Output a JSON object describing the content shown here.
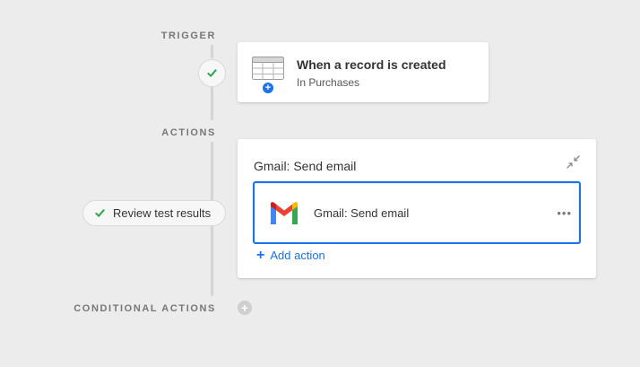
{
  "sections": {
    "trigger_label": "TRIGGER",
    "actions_label": "ACTIONS",
    "conditional_label": "CONDITIONAL ACTIONS"
  },
  "trigger": {
    "title": "When a record is created",
    "subtitle": "In Purchases",
    "icon": "table-icon",
    "status_icon": "check-icon"
  },
  "actions": {
    "header": "Gmail: Send email",
    "items": [
      {
        "label": "Gmail: Send email",
        "icon": "gmail-icon",
        "more": "•••"
      }
    ],
    "add_label": "Add action",
    "add_plus": "+"
  },
  "review": {
    "label": "Review test results",
    "icon": "check-icon"
  },
  "conditional": {
    "add_plus": "+"
  },
  "colors": {
    "accent": "#1a73e8",
    "success": "#2ea44f",
    "background": "#ececec"
  }
}
